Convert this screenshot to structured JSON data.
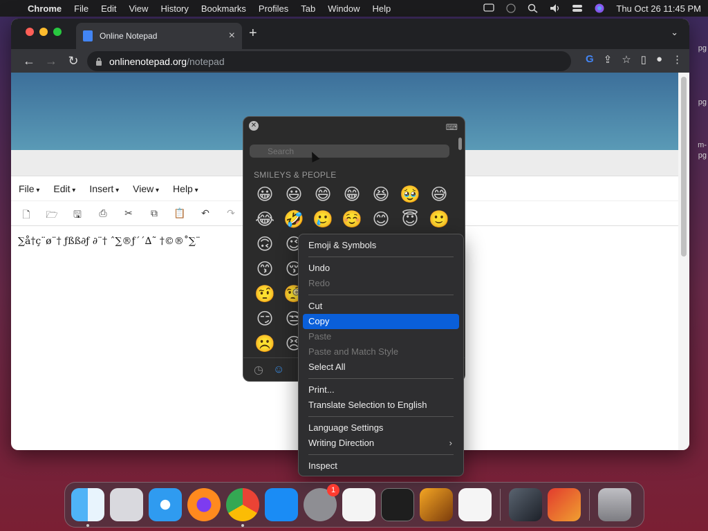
{
  "menubar": {
    "app": "Chrome",
    "items": [
      "File",
      "Edit",
      "View",
      "History",
      "Bookmarks",
      "Profiles",
      "Tab",
      "Window",
      "Help"
    ],
    "datetime": "Thu Oct 26  11:45 PM"
  },
  "browser": {
    "tab_title": "Online Notepad",
    "url_host": "onlinenotepad.org",
    "url_path": "/notepad"
  },
  "notepad": {
    "menus": [
      "File",
      "Edit",
      "Insert",
      "View",
      "Help"
    ],
    "content": "∑å†ç¨ø¨† ƒßß∂ƒ ∂¨† ˆ∑®ƒ´´∆˜ †©®˚∑¨"
  },
  "emoji_picker": {
    "search_placeholder": "Search",
    "category": "SMILEYS & PEOPLE",
    "emojis": [
      "😀",
      "😃",
      "😄",
      "😁",
      "😆",
      "🥹",
      "😅",
      "😂",
      "🤣",
      "🥲",
      "☺️",
      "😊",
      "😇",
      "🙂",
      "🙃",
      "😉",
      "",
      "",
      "",
      "",
      "",
      "😙",
      "😚",
      "",
      "",
      "",
      "",
      "",
      "🤨",
      "🧐",
      "",
      "",
      "",
      "",
      "",
      "😏",
      "😒",
      "",
      "",
      "",
      "",
      "",
      "☹️",
      "😣",
      "",
      "",
      "",
      "",
      ""
    ]
  },
  "context_menu": {
    "items": [
      {
        "label": "Emoji & Symbols",
        "state": "normal"
      },
      {
        "sep": true
      },
      {
        "label": "Undo",
        "state": "normal"
      },
      {
        "label": "Redo",
        "state": "disabled"
      },
      {
        "sep": true
      },
      {
        "label": "Cut",
        "state": "normal"
      },
      {
        "label": "Copy",
        "state": "highlighted"
      },
      {
        "label": "Paste",
        "state": "disabled"
      },
      {
        "label": "Paste and Match Style",
        "state": "disabled"
      },
      {
        "label": "Select All",
        "state": "normal"
      },
      {
        "sep": true
      },
      {
        "label": "Print...",
        "state": "normal"
      },
      {
        "label": "Translate Selection to English",
        "state": "normal"
      },
      {
        "sep": true
      },
      {
        "label": "Language Settings",
        "state": "normal"
      },
      {
        "label": "Writing Direction",
        "state": "normal",
        "submenu": true
      },
      {
        "sep": true
      },
      {
        "label": "Inspect",
        "state": "normal"
      }
    ]
  },
  "dock": {
    "apps": [
      "Finder",
      "Launchpad",
      "Safari",
      "Firefox",
      "Chrome",
      "App Store",
      "System Settings",
      "TextEdit",
      "Terminal",
      "GarageBand",
      "VS Code",
      "Asphalt 8",
      "Asphalt 9",
      "Trash"
    ],
    "settings_badge": "1"
  },
  "desktop_labels": [
    "pg",
    "pg",
    "m-",
    "pg"
  ],
  "colors": {
    "menu_highlight": "#0a5fd9",
    "chrome_dark": "#35363a"
  }
}
